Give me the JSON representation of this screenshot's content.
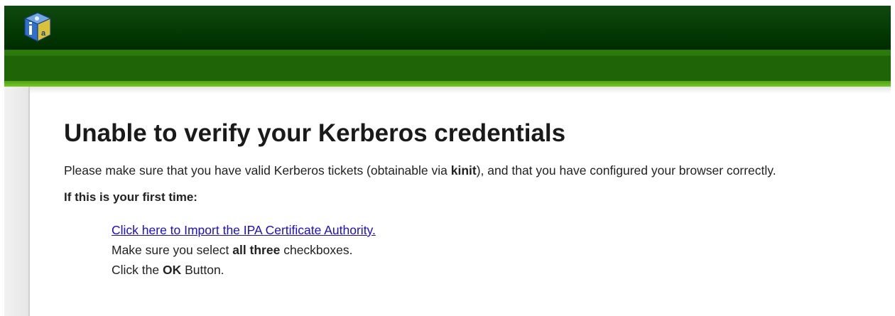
{
  "header": {
    "logo_icon": "ipa-cube-logo-icon",
    "colors": {
      "topbar": "#003300",
      "navbar": "#1f6406",
      "accent": "#73c821"
    }
  },
  "main": {
    "title": "Unable to verify your Kerberos credentials",
    "message": {
      "before": "Please make sure that you have valid Kerberos tickets (obtainable via ",
      "command": "kinit",
      "after": "), and that you have configured your browser correctly."
    },
    "first_time_heading": "If this is your first time:",
    "steps": {
      "import_link": "Click here to Import the IPA Certificate Authority.",
      "select_before": "Make sure you select ",
      "select_bold": "all three",
      "select_after": " checkboxes.",
      "ok_before": "Click the ",
      "ok_bold": "OK",
      "ok_after": " Button."
    }
  }
}
